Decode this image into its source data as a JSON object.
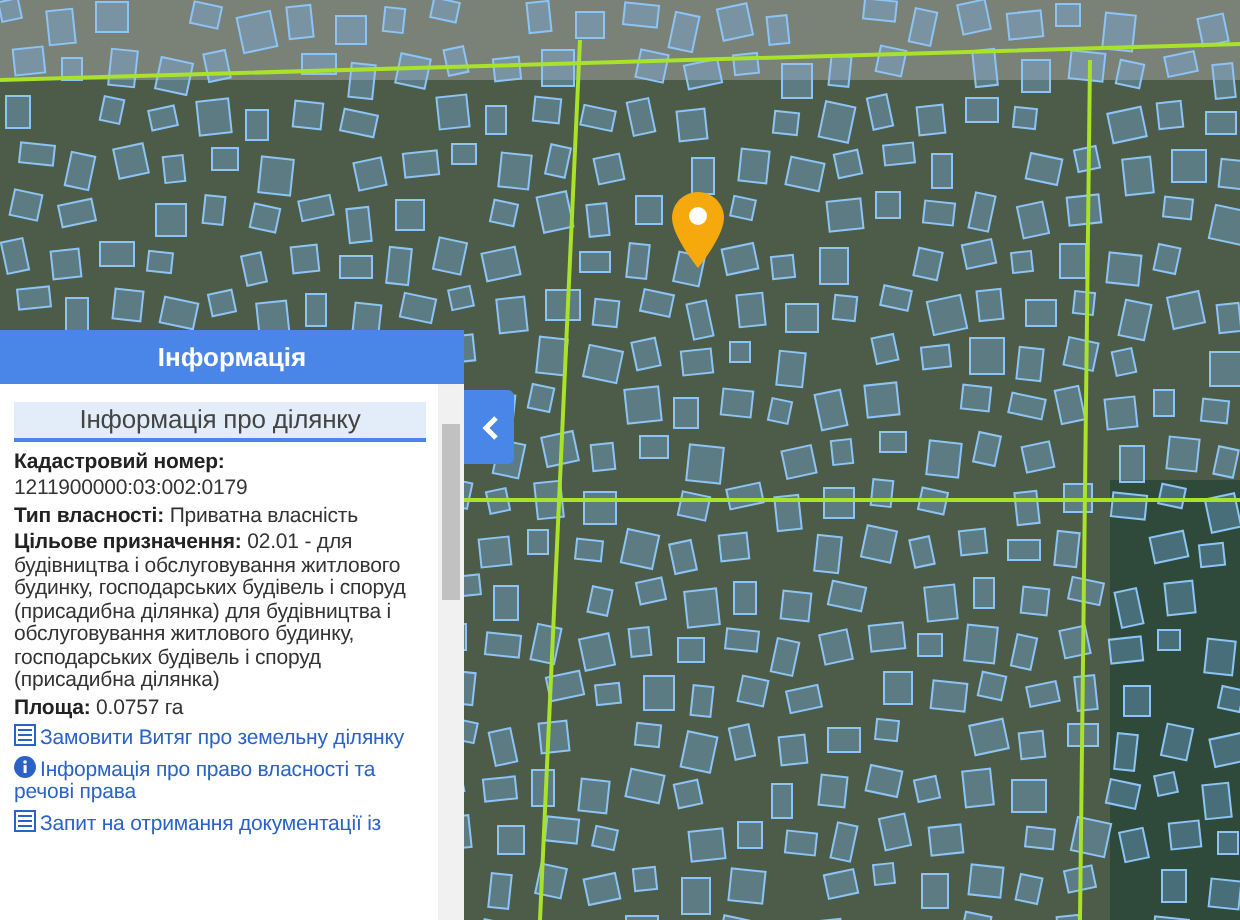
{
  "panel": {
    "title": "Інформація",
    "section_title": "Інформація про ділянку",
    "fields": [
      {
        "kind": "block",
        "label": "Кадастровий номер:",
        "value": "1211900000:03:002:0179"
      },
      {
        "kind": "inline",
        "label": "Тип власності:",
        "value": "Приватна власність"
      },
      {
        "kind": "inline",
        "label": "Цільове призначення:",
        "value": "02.01 - для будівництва і обслуговування житлового будинку, господарських будівель і споруд (присадибна ділянка) для будівництва і обслуговування житлового будинку, господарських будівель і споруд (присадибна ділянка)"
      },
      {
        "kind": "inline",
        "label": "Площа:",
        "value": "0.0757 га"
      }
    ],
    "links": [
      {
        "kind": "document",
        "text": "Замовити Витяг про земельну ділянку"
      },
      {
        "kind": "info",
        "text": "Інформація про право власності та речові права"
      },
      {
        "kind": "document",
        "text": "Запит на отримання документації із"
      }
    ]
  }
}
